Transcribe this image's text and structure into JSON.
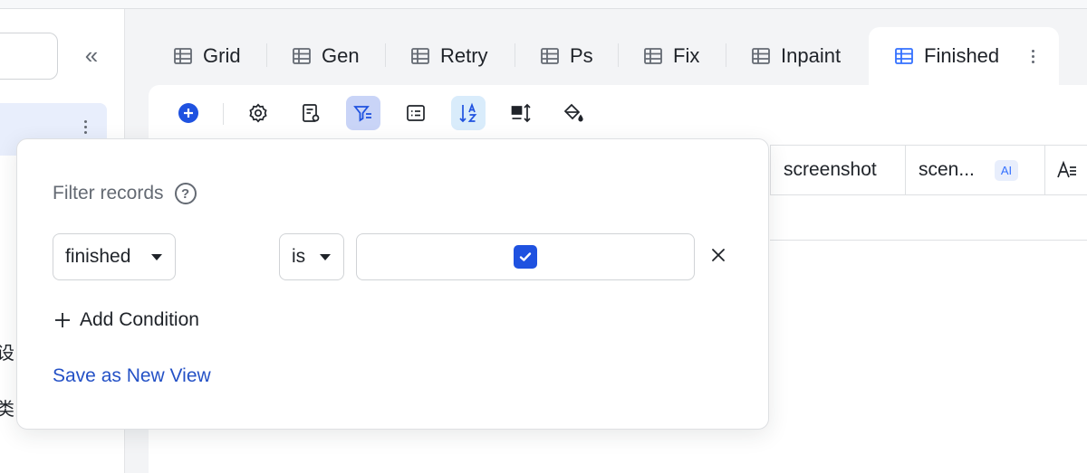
{
  "sidebar": {
    "collapse_glyph": "«",
    "partial_texts": [
      "设",
      "类"
    ]
  },
  "tabs": [
    {
      "label": "Grid",
      "icon": "grid-view-icon"
    },
    {
      "label": "Gen",
      "icon": "grid-view-icon"
    },
    {
      "label": "Retry",
      "icon": "grid-view-icon"
    },
    {
      "label": "Ps",
      "icon": "grid-view-icon"
    },
    {
      "label": "Fix",
      "icon": "grid-view-icon"
    },
    {
      "label": "Inpaint",
      "icon": "grid-view-icon"
    },
    {
      "label": "Finished",
      "icon": "grid-view-icon",
      "active": true
    }
  ],
  "toolbar": {
    "items": [
      "add-record-icon",
      "settings-icon",
      "field-config-icon",
      "filter-icon",
      "group-icon",
      "sort-icon",
      "row-height-icon",
      "color-fill-icon"
    ],
    "active": [
      "filter-icon",
      "sort-icon"
    ]
  },
  "grid": {
    "columns": [
      {
        "label": "screenshot"
      },
      {
        "label": "scen...",
        "badge": "AI"
      }
    ]
  },
  "filter": {
    "title": "Filter records",
    "field": "finished",
    "operator": "is",
    "value_checked": true,
    "add_condition": "Add Condition",
    "save_view": "Save as New View"
  },
  "colors": {
    "accent": "#1f52e0",
    "link": "#2451c6",
    "filter_active_bg": "#c9d4f7",
    "sort_active_bg": "#d9ecfb"
  }
}
